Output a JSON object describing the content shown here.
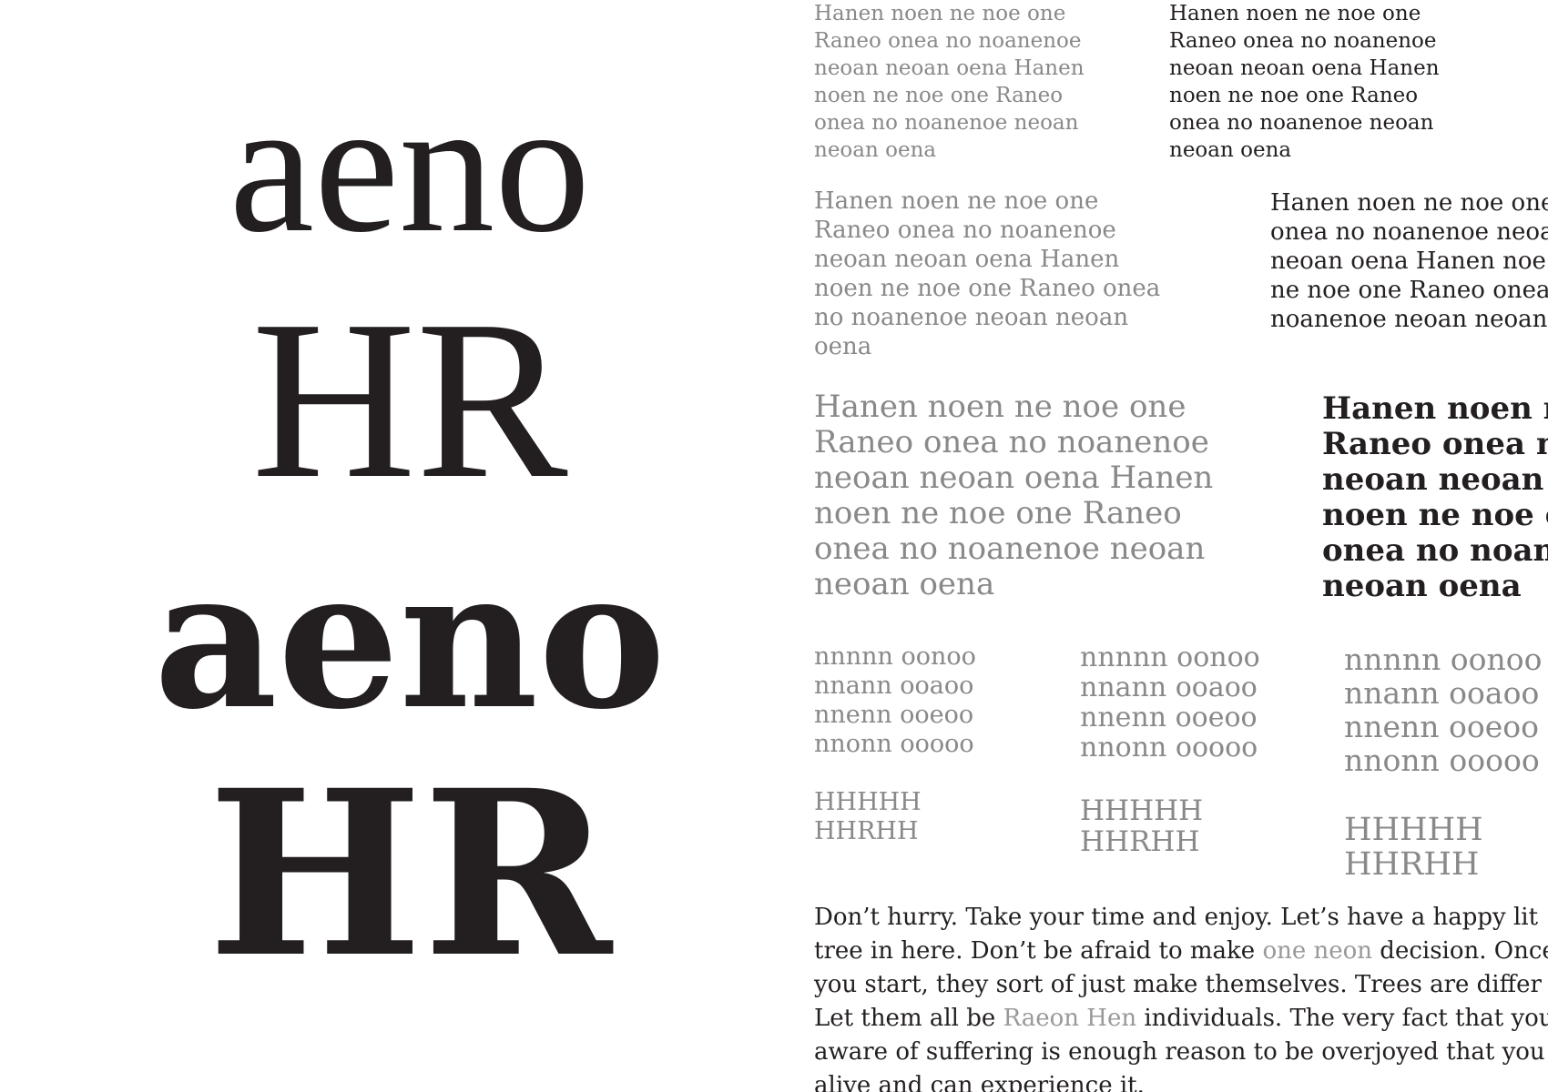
{
  "display": {
    "light_lower": "aeno",
    "light_upper": "HR",
    "bold_lower": "aeno",
    "bold_upper": "HR"
  },
  "text_samples": {
    "small_light": "Hanen noen ne noe one Raneo onea no noanenoe neoan neoan oena Hanen noen ne noe one Raneo onea no noanenoe neoan neoan oena",
    "small_dark": "Hanen noen ne noe one Raneo onea no noanenoe neoan neoan oena Hanen noen ne noe one Raneo onea no noanenoe neoan neoan oena",
    "medium_light": "Hanen noen ne noe one Raneo onea no noanenoe neoan neoan oena Hanen noen ne noe one Raneo onea no noanenoe neoan neoan oena",
    "medium_dark": "Hanen noen ne noe one onea no noanenoe neoa neoan oena Hanen noe ne noe one Raneo onea noanenoe neoan neoan",
    "large_light": "Hanen noen ne noe one Raneo onea no noanenoe neoan neoan oena Hanen noen ne noe one Raneo onea no noanenoe neoan neoan oena",
    "large_dark": "Hanen noen ne Raneo onea no neoan neoan o noen ne noe or onea no noane neoan oena"
  },
  "spacing": {
    "lower_lines": [
      "nnnnn oonoo",
      "nnann ooaoo",
      "nnenn ooeoo",
      "nnonn ooooo"
    ],
    "upper_lines": [
      "HHHHH",
      "HHRHH"
    ]
  },
  "body_text": {
    "l1": "Don’t hurry. Take your time and enjoy. Let’s have a happy lit",
    "l2a": "tree in here. Don’t be afraid to make ",
    "l2b": "one neon",
    "l2c": " decision. Once",
    "l3": "you start, they sort of just make themselves. Trees are differ",
    "l4a": "Let them all be ",
    "l4b": "Raeon Hen",
    "l4c": " individuals. The very fact that you",
    "l5": "aware of suffering is enough reason to be overjoyed that you",
    "l6": "alive and can experience it."
  }
}
